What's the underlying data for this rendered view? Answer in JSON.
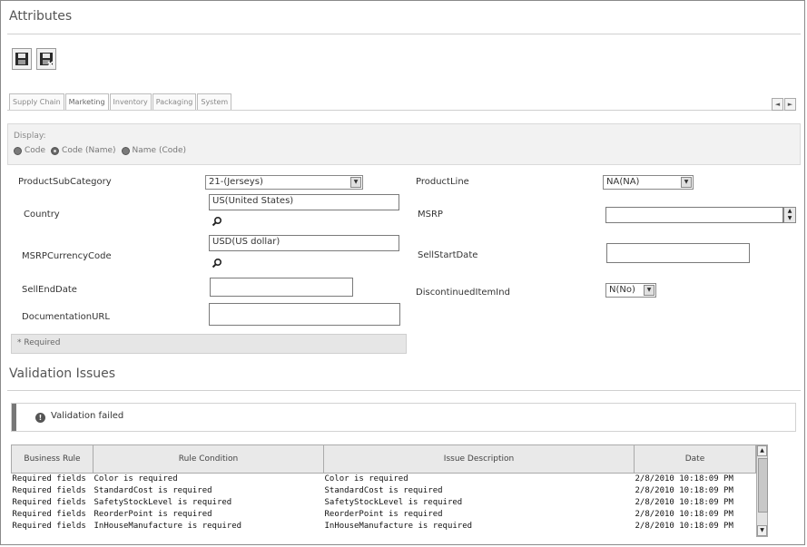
{
  "attributes": {
    "title": "Attributes"
  },
  "toolbar": {
    "save_icon": "save-icon",
    "save_close_icon": "save-close-icon"
  },
  "tabs": [
    "Supply Chain",
    "Marketing",
    "Inventory",
    "Packaging",
    "System"
  ],
  "tab_scroll": {
    "left": "◄",
    "right": "►"
  },
  "display": {
    "label": "Display:",
    "options": [
      "Code",
      "Code (Name)",
      "Name (Code)"
    ],
    "selected": "Code (Name)"
  },
  "form": {
    "product_sub_category": {
      "label": "ProductSubCategory",
      "value": "21-(Jerseys)"
    },
    "country": {
      "label": "Country",
      "value": "US(United States)"
    },
    "msrp_currency_code": {
      "label": "MSRPCurrencyCode",
      "value": "USD(US dollar)"
    },
    "sell_end_date": {
      "label": "SellEndDate",
      "value": ""
    },
    "documentation_url": {
      "label": "DocumentationURL",
      "value": ""
    },
    "product_line": {
      "label": "ProductLine",
      "value": "NA(NA)"
    },
    "msrp": {
      "label": "MSRP",
      "value": ""
    },
    "sell_start_date": {
      "label": "SellStartDate",
      "value": ""
    },
    "discontinued_item_ind": {
      "label": "DiscontinuedItemInd",
      "value": "N(No)"
    }
  },
  "required_note": "* Required",
  "validation": {
    "title": "Validation Issues",
    "status": "Validation failed",
    "columns": [
      "Business Rule",
      "Rule Condition",
      "Issue Description",
      "Date"
    ],
    "rows": [
      [
        "Required fields",
        "Color is required",
        "Color is required",
        "2/8/2010 10:18:09 PM"
      ],
      [
        "Required fields",
        "StandardCost is required",
        "StandardCost is required",
        "2/8/2010 10:18:09 PM"
      ],
      [
        "Required fields",
        "SafetyStockLevel is required",
        "SafetyStockLevel is required",
        "2/8/2010 10:18:09 PM"
      ],
      [
        "Required fields",
        "ReorderPoint is required",
        "ReorderPoint is required",
        "2/8/2010 10:18:09 PM"
      ],
      [
        "Required fields",
        "InHouseManufacture is required",
        "InHouseManufacture is required",
        "2/8/2010 10:18:09 PM"
      ]
    ]
  }
}
